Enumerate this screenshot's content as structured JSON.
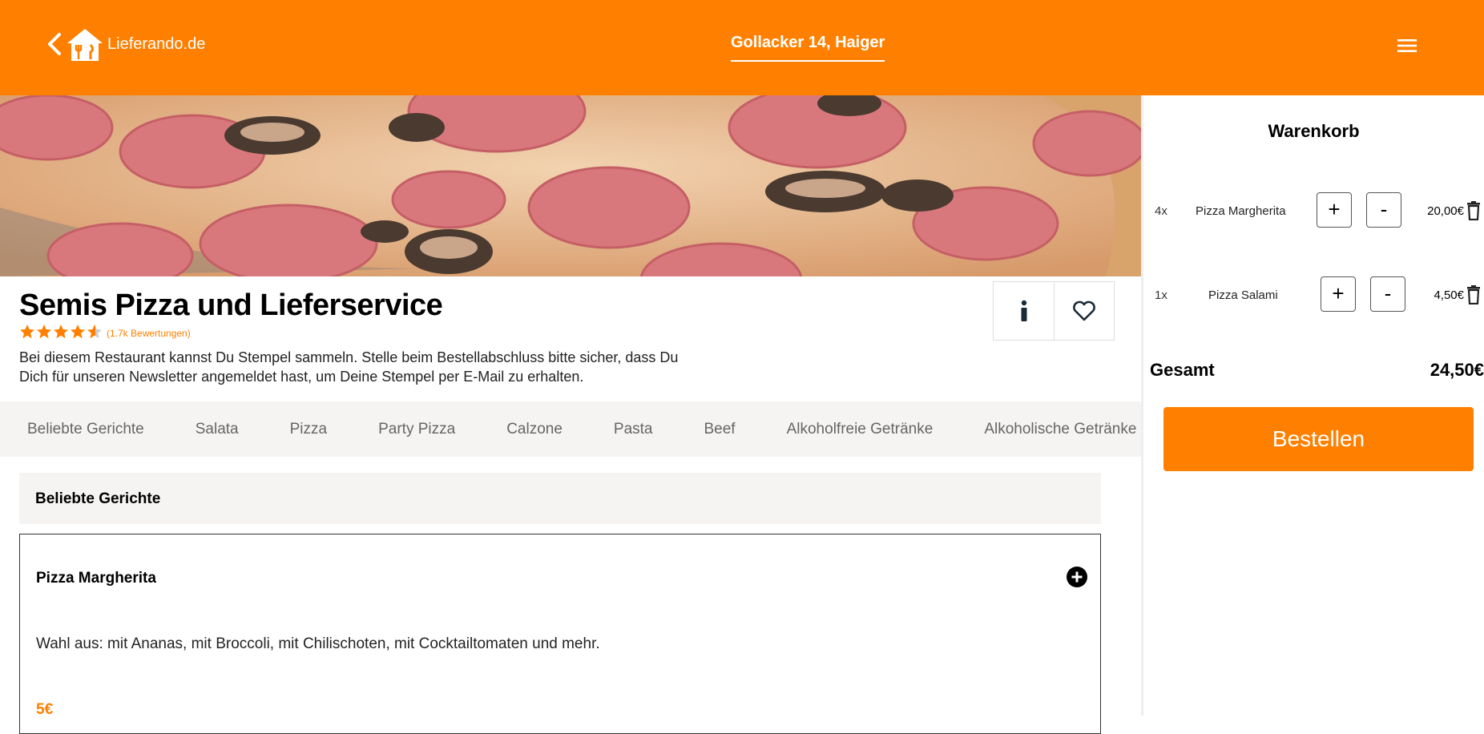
{
  "header": {
    "brand": "Lieferando.de",
    "address": "Gollacker 14, Haiger",
    "accent_color": "#ff8000"
  },
  "restaurant": {
    "name": "Semis Pizza und Lieferservice",
    "rating_stars": 4.5,
    "rating_text": "(1.7k Bewertungen)",
    "description": "Bei diesem Restaurant kannst Du Stempel sammeln. Stelle beim Bestellabschluss bitte sicher, dass Du Dich für unseren Newsletter angemeldet hast, um Deine Stempel per E-Mail zu erhalten."
  },
  "categories": [
    "Beliebte Gerichte",
    "Salata",
    "Pizza",
    "Party Pizza",
    "Calzone",
    "Pasta",
    "Beef",
    "Alkoholfreie Getränke",
    "Alkoholische Getränke"
  ],
  "menu": {
    "section_title": "Beliebte Gerichte",
    "item": {
      "name": "Pizza Margherita",
      "description": "Wahl aus: mit Ananas, mit Broccoli, mit Chilischoten, mit Cocktailtomaten und mehr.",
      "price": "5€"
    }
  },
  "cart": {
    "title": "Warenkorb",
    "items": [
      {
        "qty": "4x",
        "name": "Pizza Margherita",
        "plus": "+",
        "minus": "-",
        "price": "20,00€"
      },
      {
        "qty": "1x",
        "name": "Pizza Salami",
        "plus": "+",
        "minus": "-",
        "price": "4,50€"
      }
    ],
    "total_label": "Gesamt",
    "total_value": "24,50€",
    "order_button": "Bestellen"
  }
}
